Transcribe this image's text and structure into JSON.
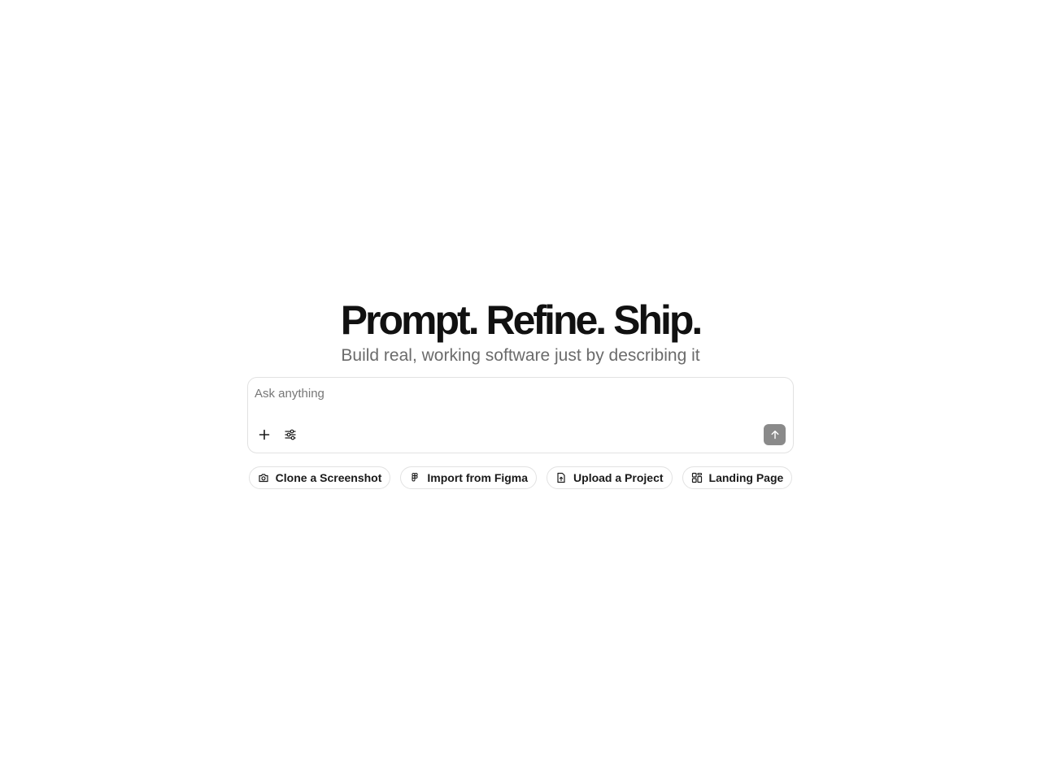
{
  "hero": {
    "headline": "Prompt. Refine. Ship.",
    "subheadline": "Build real, working software just by describing it"
  },
  "composer": {
    "placeholder": "Ask anything",
    "value": "",
    "attach_icon": "plus-icon",
    "settings_icon": "sliders-icon",
    "send_icon": "arrow-up-icon"
  },
  "suggestions": [
    {
      "label": "Clone a Screenshot",
      "icon": "camera-icon"
    },
    {
      "label": "Import from Figma",
      "icon": "figma-icon"
    },
    {
      "label": "Upload a Project",
      "icon": "file-upload-icon"
    },
    {
      "label": "Landing Page",
      "icon": "layout-grid-icon"
    }
  ],
  "colors": {
    "headline": "#111111",
    "subheadline": "#6b6b6b",
    "border": "#e2e2e2",
    "send_button": "#8a8a8a"
  }
}
